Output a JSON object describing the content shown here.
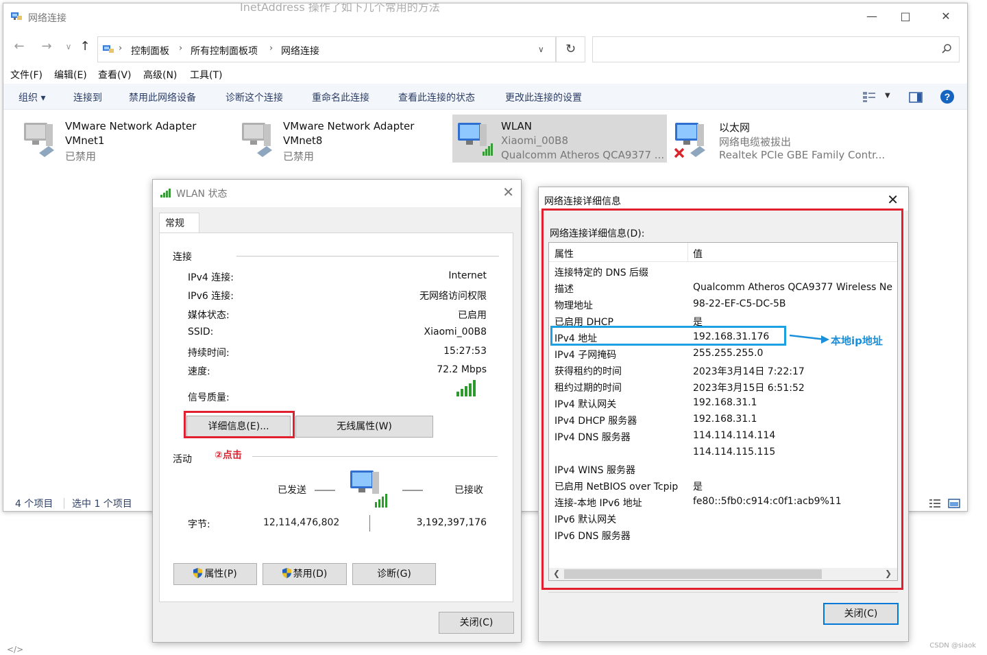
{
  "explorer": {
    "title": "网络连接",
    "ghost_title": "InetAddress 操作了如下几个常用的方法",
    "breadcrumbs": [
      "控制面板",
      "所有控制面板项",
      "网络连接"
    ],
    "menu": [
      "文件(F)",
      "编辑(E)",
      "查看(V)",
      "高级(N)",
      "工具(T)"
    ],
    "commands": [
      "组织 ▾",
      "连接到",
      "禁用此网络设备",
      "诊断这个连接",
      "重命名此连接",
      "查看此连接的状态",
      "更改此连接的设置"
    ],
    "items": [
      {
        "name": "VMware Network Adapter",
        "line2": "VMnet1",
        "line3": "已禁用"
      },
      {
        "name": "VMware Network Adapter",
        "line2": "VMnet8",
        "line3": "已禁用"
      },
      {
        "name": "WLAN",
        "line2": "Xiaomi_00B8",
        "line3": "Qualcomm Atheros QCA9377 ..."
      },
      {
        "name": "以太网",
        "line2": "网络电缆被拔出",
        "line3": "Realtek PCIe GBE Family Contr..."
      }
    ],
    "status": {
      "count": "4 个项目",
      "selected": "选中 1 个项目"
    }
  },
  "wlan_dialog": {
    "title": "WLAN 状态",
    "tab": "常规",
    "connection_group": "连接",
    "rows": [
      {
        "key": "IPv4 连接:",
        "value": "Internet"
      },
      {
        "key": "IPv6 连接:",
        "value": "无网络访问权限"
      },
      {
        "key": "媒体状态:",
        "value": "已启用"
      },
      {
        "key": "SSID:",
        "value": "Xiaomi_00B8"
      },
      {
        "key": "持续时间:",
        "value": "15:27:53"
      },
      {
        "key": "速度:",
        "value": "72.2 Mbps"
      }
    ],
    "signal_label": "信号质量:",
    "details_button": "详细信息(E)...",
    "wireless_button": "无线属性(W)",
    "activity_group": "活动",
    "sent_label": "已发送",
    "received_label": "已接收",
    "bytes_label": "字节:",
    "bytes_sent": "12,114,476,802",
    "bytes_received": "3,192,397,176",
    "properties_button": "属性(P)",
    "disable_button": "禁用(D)",
    "diagnose_button": "诊断(G)",
    "close_button": "关闭(C)"
  },
  "details_dialog": {
    "title": "网络连接详细信息",
    "label": "网络连接详细信息(D):",
    "col_property": "属性",
    "col_value": "值",
    "rows": [
      {
        "prop": "连接特定的 DNS 后缀",
        "value": ""
      },
      {
        "prop": "描述",
        "value": "Qualcomm Atheros QCA9377 Wireless Ne"
      },
      {
        "prop": "物理地址",
        "value": "98-22-EF-C5-DC-5B"
      },
      {
        "prop": "已启用 DHCP",
        "value": "是"
      },
      {
        "prop": "IPv4 地址",
        "value": "192.168.31.176"
      },
      {
        "prop": "IPv4 子网掩码",
        "value": "255.255.255.0"
      },
      {
        "prop": "获得租约的时间",
        "value": "2023年3月14日 7:22:17"
      },
      {
        "prop": "租约过期的时间",
        "value": "2023年3月15日 6:51:52"
      },
      {
        "prop": "IPv4 默认网关",
        "value": "192.168.31.1"
      },
      {
        "prop": "IPv4 DHCP 服务器",
        "value": "192.168.31.1"
      },
      {
        "prop": "IPv4 DNS 服务器",
        "value": "114.114.114.114"
      },
      {
        "prop": "",
        "value": "114.114.115.115"
      },
      {
        "prop": "IPv4 WINS 服务器",
        "value": ""
      },
      {
        "prop": "已启用 NetBIOS over Tcpip",
        "value": "是"
      },
      {
        "prop": "连接-本地 IPv6 地址",
        "value": "fe80::5fb0:c914:c0f1:acb9%11"
      },
      {
        "prop": "IPv6 默认网关",
        "value": ""
      },
      {
        "prop": "IPv6 DNS 服务器",
        "value": ""
      }
    ],
    "close_button": "关闭(C)"
  },
  "annotations": {
    "click_note": "②点击",
    "ip_note": "本地ip地址",
    "watermark": "CSDN @siaok",
    "corner_glyph": "</>",
    "colors": {
      "red": "#e0202e",
      "blue": "#1ba1e2"
    }
  }
}
